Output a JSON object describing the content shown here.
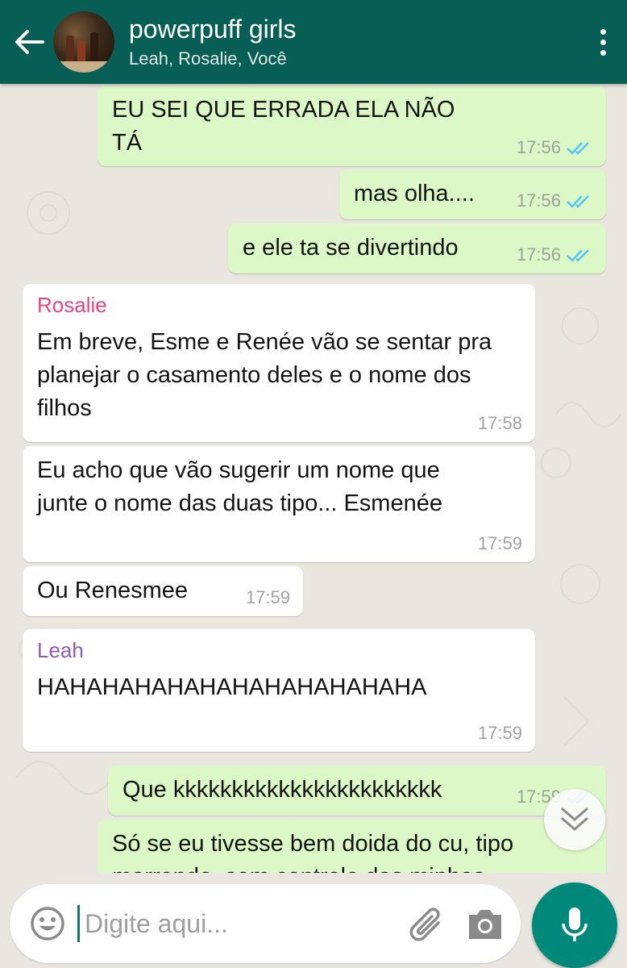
{
  "header": {
    "title": "powerpuff girls",
    "members": "Leah, Rosalie, Você"
  },
  "messages": [
    {
      "direction": "out",
      "text": "EU SEI QUE ERRADA ELA NÃO TÁ",
      "time": "17:56",
      "status": "read"
    },
    {
      "direction": "out",
      "text": "mas olha....",
      "time": "17:56",
      "status": "read"
    },
    {
      "direction": "out",
      "text": "e ele ta se divertindo",
      "time": "17:56",
      "status": "read"
    },
    {
      "direction": "in",
      "sender": "Rosalie",
      "text": "Em breve, Esme e Renée vão se sentar pra planejar o casamento deles e o nome dos filhos",
      "time": "17:58"
    },
    {
      "direction": "in",
      "text": "Eu acho que vão sugerir um nome que junte o nome das duas tipo... Esmenée",
      "time": "17:59"
    },
    {
      "direction": "in",
      "text": "Ou Renesmee",
      "time": "17:59"
    },
    {
      "direction": "in",
      "sender": "Leah",
      "text": "HAHAHAHAHAHAHAHAHAHAHAHA",
      "time": "17:59"
    },
    {
      "direction": "out",
      "text": "Que kkkkkkkkkkkkkkkkkkkkkkk",
      "time": "17:59",
      "status": "read"
    },
    {
      "direction": "out",
      "text": "Só se eu tivesse bem doida do cu, tipo morrendo, sem controle das minhas",
      "time": "",
      "status": ""
    }
  ],
  "sender_colors": {
    "Rosalie": "#e8457a",
    "Leah": "#8e5bb5"
  },
  "input": {
    "placeholder": "Digite aqui..."
  },
  "colors": {
    "header": "#075e54",
    "outgoing": "#dcf8c6",
    "incoming": "#ffffff",
    "tick_read": "#4fc3f7",
    "fab": "#00897b"
  },
  "icons": {
    "back": "arrow-left-icon",
    "menu": "more-vertical-icon",
    "emoji": "smiley-icon",
    "attach": "paperclip-icon",
    "camera": "camera-icon",
    "mic": "microphone-icon",
    "scroll": "double-chevron-down-icon"
  }
}
